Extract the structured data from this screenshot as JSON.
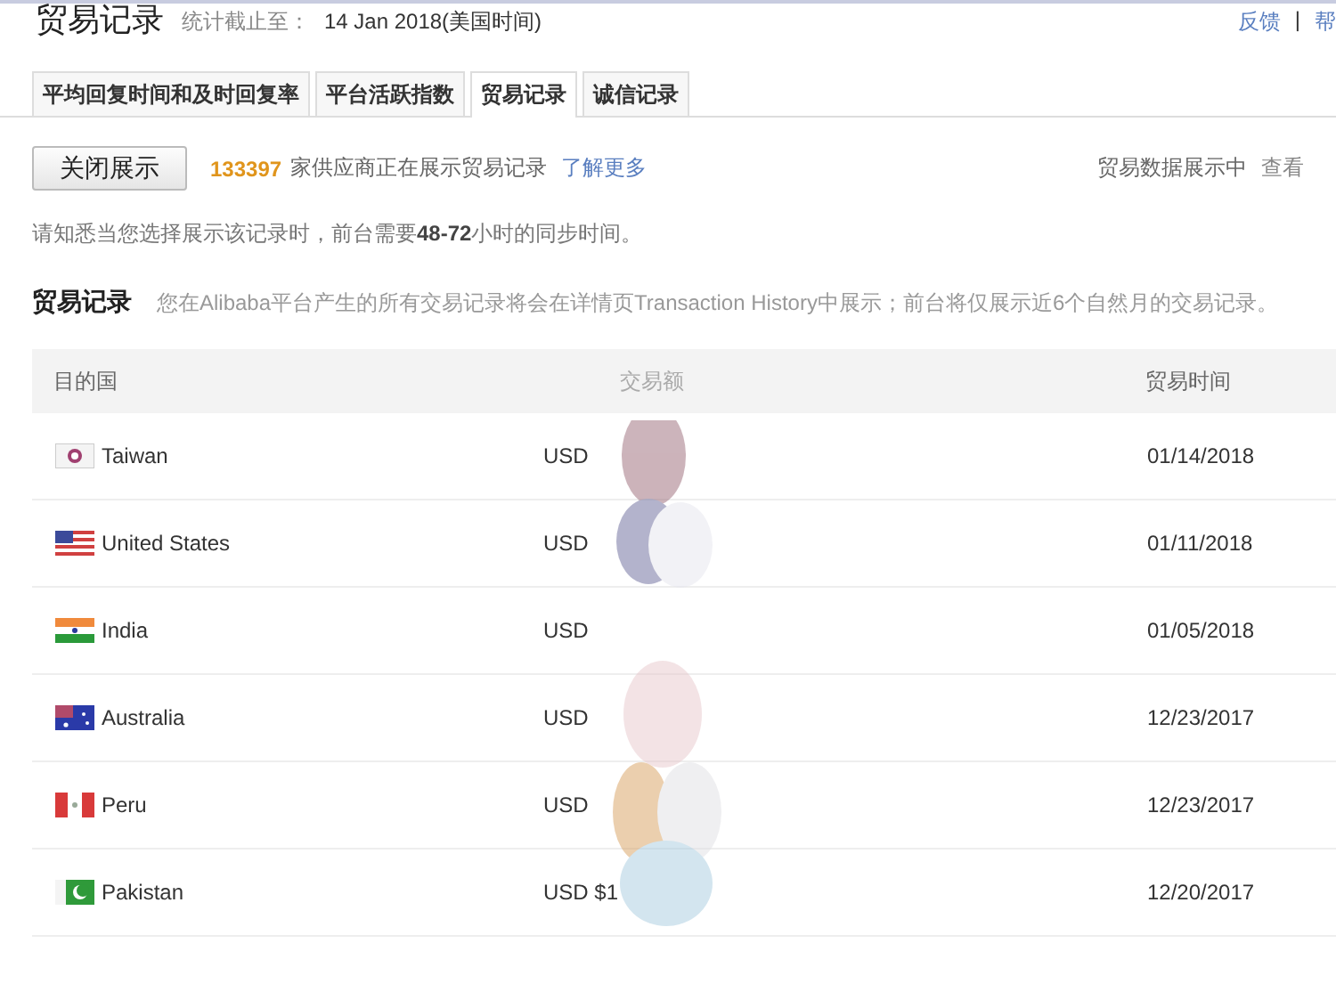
{
  "header": {
    "title": "贸易记录",
    "stats_label": "统计截止至：",
    "stats_date": "14 Jan 2018(美国时间)",
    "links": [
      "反馈",
      "帮"
    ],
    "separator": "|"
  },
  "tabs": [
    {
      "label": "平均回复时间和及时回复率",
      "selected": false
    },
    {
      "label": "平台活跃指数",
      "selected": false
    },
    {
      "label": "贸易记录",
      "selected": true
    },
    {
      "label": "诚信记录",
      "selected": false
    }
  ],
  "toolbar": {
    "button": "关闭展示",
    "count": "133397",
    "count_text": "家供应商正在展示贸易记录",
    "learn_more": "了解更多",
    "status": "贸易数据展示中",
    "view": "查看"
  },
  "notice": "请知悉当您选择展示该记录时，前台需要**48-72**小时的同步时间。",
  "section": {
    "title": "贸易记录",
    "description": "您在Alibaba平台产生的所有交易记录将会在详情页Transaction History中展示；前台将仅展示近6个自然月的交易记录。"
  },
  "table": {
    "columns": [
      "目的国",
      "交易额",
      "贸易时间"
    ],
    "rows": [
      {
        "kind": "tw",
        "country": "Taiwan",
        "amount": "USD",
        "date": "01/14/2018"
      },
      {
        "kind": "us",
        "country": "United States",
        "amount": "USD",
        "date": "01/11/2018"
      },
      {
        "kind": "in",
        "country": "India",
        "amount": "USD",
        "date": "01/05/2018"
      },
      {
        "kind": "au",
        "country": "Australia",
        "amount": "USD",
        "date": "12/23/2017"
      },
      {
        "kind": "pe",
        "country": "Peru",
        "amount": "USD",
        "date": "12/23/2017"
      },
      {
        "kind": "pk",
        "country": "Pakistan",
        "amount": "USD $1",
        "date": "12/20/2017"
      }
    ]
  }
}
